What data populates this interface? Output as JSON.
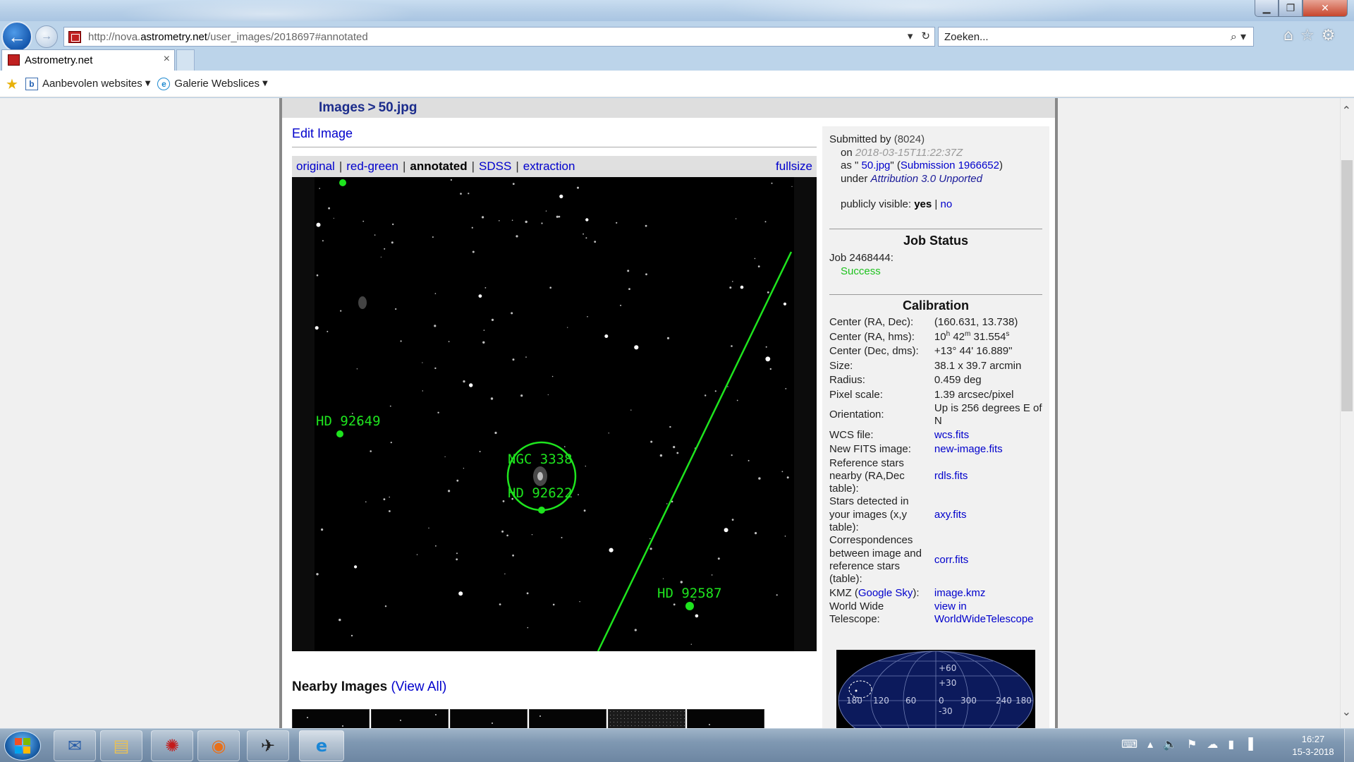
{
  "browser": {
    "url_prefix": "http://nova.",
    "url_domain": "astrometry.net",
    "url_path": "/user_images/2018697#annotated",
    "search_placeholder": "Zoeken...",
    "tab_title": "Astrometry.net",
    "favorites": [
      {
        "label": "Aanbevolen websites",
        "icon": "bing-icon"
      },
      {
        "label": "Galerie Webslices",
        "icon": "ie-icon"
      }
    ]
  },
  "page": {
    "breadcrumb_root": "Images",
    "breadcrumb_sep": ">",
    "breadcrumb_file": "50.jpg",
    "edit_link": "Edit Image",
    "image_tabs": [
      "original",
      "red-green",
      "annotated",
      "SDSS",
      "extraction"
    ],
    "image_tab_sep": "|",
    "active_tab": "annotated",
    "fullsize": "fullsize",
    "annotations": {
      "galaxy": "NGC 3338",
      "star_center": "HD 92622",
      "star_left": "HD 92649",
      "star_right": "HD 92587"
    },
    "nearby_title": "Nearby Images",
    "nearby_view_all": "View All"
  },
  "panel": {
    "submitted_by_label": "Submitted by",
    "submitted_by_user": "(8024)",
    "on_label": "on",
    "date": "2018-03-15T11:22:37Z",
    "as_label": "as \"",
    "file": "50.jpg",
    "as_close": "\" (",
    "submission": "Submission 1966652",
    "as_end": ")",
    "under_label": "under",
    "license": "Attribution 3.0 Unported",
    "visible_label": "publicly visible:",
    "visible_yes": "yes",
    "visible_sep": "|",
    "visible_no": "no",
    "job_status_title": "Job Status",
    "job_label": "Job 2468444:",
    "job_result": "Success",
    "calibration_title": "Calibration"
  },
  "calibration": [
    {
      "key": "Center (RA, Dec):",
      "value": "(160.631, 13.738)"
    },
    {
      "key": "Center (RA, hms):",
      "value_h": "10",
      "value_m": "42",
      "value_s": "31.554"
    },
    {
      "key": "Center (Dec, dms):",
      "value": "+13° 44' 16.889\""
    },
    {
      "key": "Size:",
      "value": "38.1 x 39.7 arcmin"
    },
    {
      "key": "Radius:",
      "value": "0.459 deg"
    },
    {
      "key": "Pixel scale:",
      "value": "1.39 arcsec/pixel"
    },
    {
      "key": "Orientation:",
      "value": "Up is 256 degrees E of N"
    },
    {
      "key": "WCS file:",
      "value": "wcs.fits"
    },
    {
      "key": "New FITS image:",
      "value": "new-image.fits"
    },
    {
      "key": "Reference stars nearby (RA,Dec table):",
      "value": "rdls.fits"
    },
    {
      "key": "Stars detected in your images (x,y table):",
      "value": "axy.fits"
    },
    {
      "key": "Correspondences between image and reference stars (table):",
      "value": "corr.fits"
    },
    {
      "key_pre": "KMZ (",
      "key_link": "Google Sky",
      "key_post": "):",
      "value": "image.kmz"
    },
    {
      "key": "World Wide Telescope:",
      "value": "view in WorldWideTelescope"
    }
  ],
  "skymap": {
    "lat_labels": [
      "+60",
      "+30",
      "0",
      "-30"
    ],
    "lon_labels": [
      "180",
      "120",
      "60",
      "0",
      "300",
      "240",
      "180"
    ]
  },
  "taskbar": {
    "time": "16:27",
    "date": "15-3-2018",
    "apps": [
      "thunderbird-icon",
      "file-explorer-icon",
      "stellarium-icon",
      "firefox-icon",
      "telescope-icon",
      "internet-explorer-icon"
    ]
  },
  "colors": {
    "link": "#0000cc",
    "annotation_green": "#1ee41e",
    "success_green": "#1ec21e"
  }
}
